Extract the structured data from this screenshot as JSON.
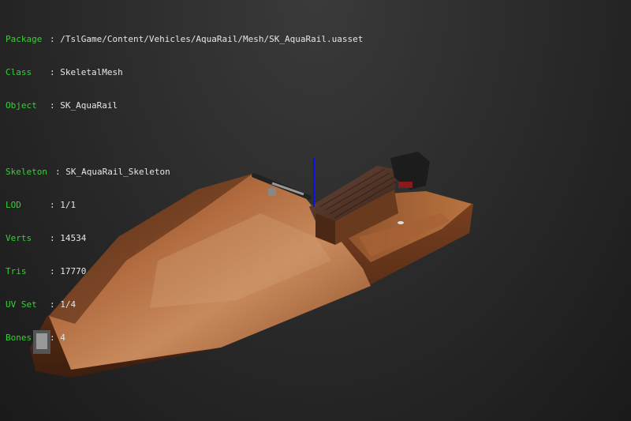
{
  "info": {
    "package": {
      "label": "Package",
      "value": "/TslGame/Content/Vehicles/AquaRail/Mesh/SK_AquaRail.uasset"
    },
    "class": {
      "label": "Class",
      "value": "SkeletalMesh"
    },
    "object": {
      "label": "Object",
      "value": "SK_AquaRail"
    },
    "skeleton": {
      "label": "Skeleton",
      "value": "SK_AquaRail_Skeleton"
    },
    "lod": {
      "label": "LOD",
      "value": "1/1"
    },
    "verts": {
      "label": "Verts",
      "value": "14534"
    },
    "tris": {
      "label": "Tris",
      "value": "17770"
    },
    "uvset": {
      "label": "UV Set",
      "value": "1/4"
    },
    "bones": {
      "label": "Bones",
      "value": "4"
    }
  },
  "colors": {
    "label_green": "#34d234",
    "text_white": "#e6e6e6",
    "background": "#2c2c2c",
    "hull_wood": "#a0603a",
    "axis_blue": "#1010e0"
  },
  "icons": {
    "mesh": "aquarail-boat-mesh",
    "pivot": "pivot-axis-icon"
  }
}
